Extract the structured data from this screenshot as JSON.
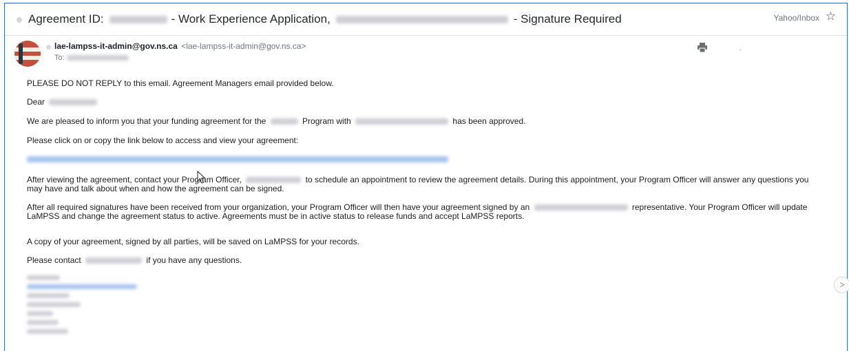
{
  "email": {
    "subject": {
      "prefix": "Agreement ID:",
      "middle": "- Work Experience Application,",
      "suffix": "- Signature Required"
    },
    "folder": "Yahoo/Inbox",
    "star_icon": "star-icon",
    "sender": {
      "name": "lae-lampss-it-admin@gov.ns.ca",
      "address": "<lae-lampss-it-admin@gov.ns.ca>",
      "to_label": "To:"
    },
    "print_icon": "print-icon",
    "body": {
      "p1": "PLEASE DO NOT REPLY to this email. Agreement Managers email provided below.",
      "p2": "Dear",
      "p3a": "We are pleased to inform you that your funding agreement for the",
      "p3b": "Program with",
      "p3c": "has been approved.",
      "p4": "Please click on or copy the link below to access and view your agreement:",
      "p5a": "After viewing the agreement, contact your Program Officer,",
      "p5b": "to schedule an appointment to review the agreement details. During this appointment, your Program Officer will answer any questions you may have and talk about when and how the agreement can be signed.",
      "p6a": "After all required signatures have been received from your organization, your Program Officer will then have your agreement signed by an",
      "p6b": "representative. Your Program Officer will update LaMPSS and change the agreement status to active. Agreements must be in active status to release funds and accept LaMPSS reports.",
      "p7": "A copy of your agreement, signed by all parties, will be saved on LaMPSS for your records.",
      "p8a": "Please contact",
      "p8b": "if you have any questions."
    }
  },
  "navigation": {
    "next_icon": "chevron-right-icon",
    "next_glyph": ">"
  }
}
